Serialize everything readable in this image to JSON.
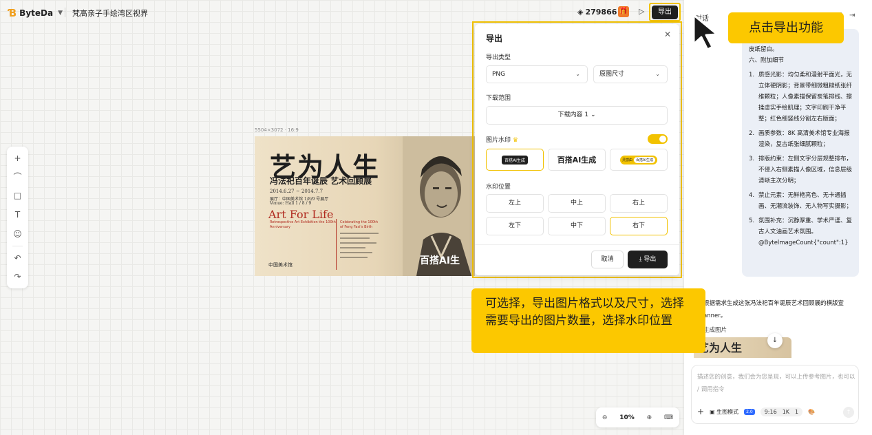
{
  "header": {
    "brand": "ByteDa",
    "project_title": "梵高亲子手绘湾区视界",
    "points": "279866",
    "export_label": "导出"
  },
  "canvas": {
    "image_meta": "5504×3072 · 16:9",
    "poster": {
      "title": "艺为人生",
      "subtitle": "冯法祀百年诞辰 艺术回顾展",
      "dates": "2014.6.27 ~ 2014.7.7",
      "hall_cn": "展厅：中国美术馆 1/8/9 号展厅",
      "hall_en": "Venue: Hall 1 / 8 / 9",
      "en_title": "Art For Life",
      "en_sub": "Retrospective Art Exhibition the 100th Anniversary",
      "en_right": "Celebrating the 100th of Feng Fasi's Birth",
      "brand": "中国美术馆",
      "watermark": "百搭AI生"
    }
  },
  "export_dialog": {
    "title": "导出",
    "type_label": "导出类型",
    "format": "PNG",
    "size": "原图尺寸",
    "range_label": "下载范围",
    "range_value": "下载内容 1",
    "watermark_label": "图片水印",
    "watermark_enabled": true,
    "watermark_option1": "百搭AI生成",
    "watermark_option2": "百搭AI生成",
    "watermark_option3_a": "灵感由",
    "watermark_option3_b": "百搭AI生成",
    "position_label": "水印位置",
    "positions": [
      "左上",
      "中上",
      "右上",
      "左下",
      "中下",
      "右下"
    ],
    "selected_position": "右下",
    "cancel": "取消",
    "confirm": "导出"
  },
  "chat": {
    "header_title": "对话",
    "bubble": {
      "line_top": "皮纸留白。",
      "section": "六、附加细节",
      "items": [
        {
          "n": "1.",
          "text": "质感光影：均匀柔和漫射平面光，无立体硬阴影；背景带细微粗糙纸张纤维颗粒；人像素描保留炭笔排线、擦揉虚实手绘肌理；文字印刷干净平整；红色细竖线分割左右版面；"
        },
        {
          "n": "2.",
          "text": "画质参数：8K 高清美术馆专业海报渲染，复古纸张细腻颗粒；"
        },
        {
          "n": "3.",
          "text": "排版约束：左侧文字分层规整排布，不侵入右侧素描人像区域，信息层级清晰主次分明；"
        },
        {
          "n": "4.",
          "text": "禁止元素：无鲜艳亮色、无卡通插画、无潮流装饰、无人物写实摄影；"
        },
        {
          "n": "5.",
          "text": "氛围补充：沉静厚重、学术严谨、复古人文油画艺术氛围。@BytelmageCount{\"count\":1}"
        }
      ]
    },
    "response": "根据需求生成这张冯法祀百年诞辰艺术回顾展的横版宣 anner。",
    "gen_label": "生成图片",
    "gen_thumb_text": "艺为人生",
    "input_placeholder": "描述您的创意，我们会为您呈现，可以上传参考图片，也可以 / 调用指令",
    "mode_label": "生图模式",
    "model_badge": "2.0",
    "ratio": "9:16",
    "resolution": "1K",
    "count": "1"
  },
  "zoom": {
    "level": "10%"
  },
  "tutorial": {
    "top_callout": "点击导出功能",
    "mid_callout": "可选择，导出图片格式以及尺寸，选择需要导出的图片数量，选择水印位置"
  },
  "colors": {
    "accent": "#fcc800",
    "dark": "#1f1f1f",
    "poster_red": "#b02a1f"
  }
}
